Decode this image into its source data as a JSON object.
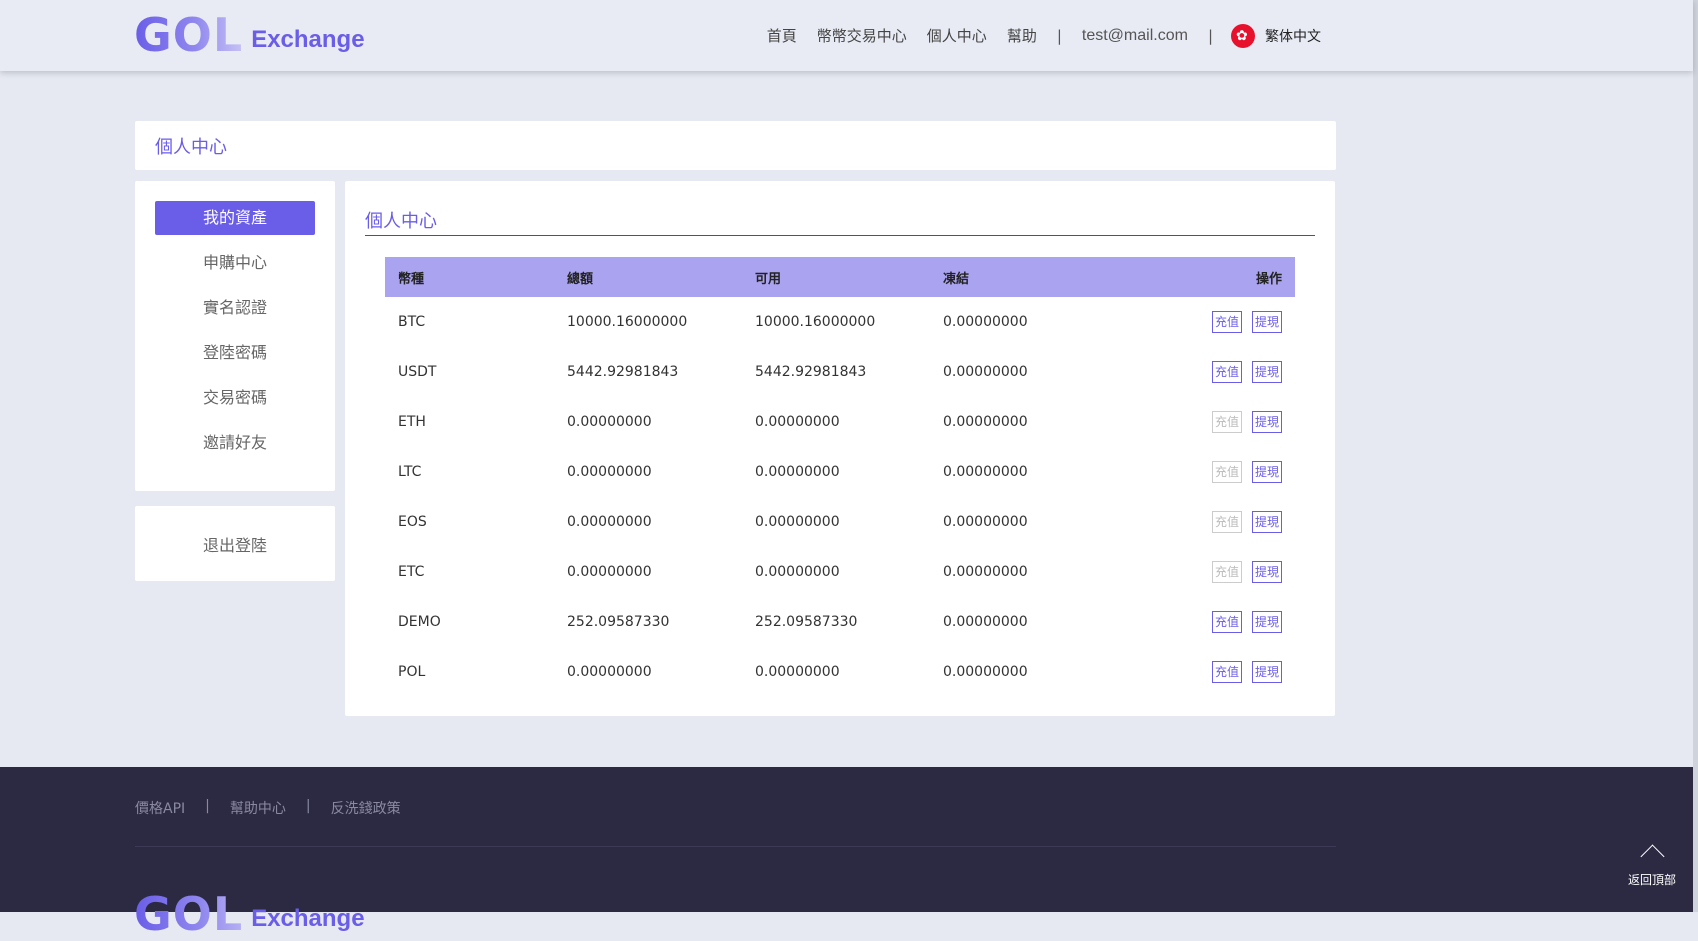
{
  "header": {
    "logo_mark": "GOL",
    "logo_text": "Exchange",
    "nav": [
      "首頁",
      "幣幣交易中心",
      "個人中心",
      "幫助"
    ],
    "separator": "|",
    "email": "test@mail.com",
    "language": "繁体中文"
  },
  "breadcrumb": {
    "title": "個人中心"
  },
  "sidebar": {
    "items": [
      {
        "label": "我的資產",
        "active": true
      },
      {
        "label": "申購中心"
      },
      {
        "label": "實名認證"
      },
      {
        "label": "登陸密碼"
      },
      {
        "label": "交易密碼"
      },
      {
        "label": "邀請好友"
      }
    ],
    "logout": "退出登陸"
  },
  "main": {
    "title": "個人中心",
    "columns": [
      "幣種",
      "總額",
      "可用",
      "凍結",
      "操作"
    ],
    "deposit_label": "充值",
    "withdraw_label": "提現",
    "rows": [
      {
        "coin": "BTC",
        "total": "10000.16000000",
        "available": "10000.16000000",
        "frozen": "0.00000000",
        "deposit_enabled": true
      },
      {
        "coin": "USDT",
        "total": "5442.92981843",
        "available": "5442.92981843",
        "frozen": "0.00000000",
        "deposit_enabled": true
      },
      {
        "coin": "ETH",
        "total": "0.00000000",
        "available": "0.00000000",
        "frozen": "0.00000000",
        "deposit_enabled": false
      },
      {
        "coin": "LTC",
        "total": "0.00000000",
        "available": "0.00000000",
        "frozen": "0.00000000",
        "deposit_enabled": false
      },
      {
        "coin": "EOS",
        "total": "0.00000000",
        "available": "0.00000000",
        "frozen": "0.00000000",
        "deposit_enabled": false
      },
      {
        "coin": "ETC",
        "total": "0.00000000",
        "available": "0.00000000",
        "frozen": "0.00000000",
        "deposit_enabled": false
      },
      {
        "coin": "DEMO",
        "total": "252.09587330",
        "available": "252.09587330",
        "frozen": "0.00000000",
        "deposit_enabled": true
      },
      {
        "coin": "POL",
        "total": "0.00000000",
        "available": "0.00000000",
        "frozen": "0.00000000",
        "deposit_enabled": true
      }
    ]
  },
  "footer": {
    "links": [
      "價格API",
      "幫助中心",
      "反洗錢政策"
    ],
    "separator": "|",
    "logo_mark": "GOL",
    "logo_text": "Exchange"
  },
  "back_to_top": "返回頂部",
  "colors": {
    "accent": "#6a5de8",
    "table_header": "#aaa3f0",
    "footer_bg": "#2c2a42"
  }
}
